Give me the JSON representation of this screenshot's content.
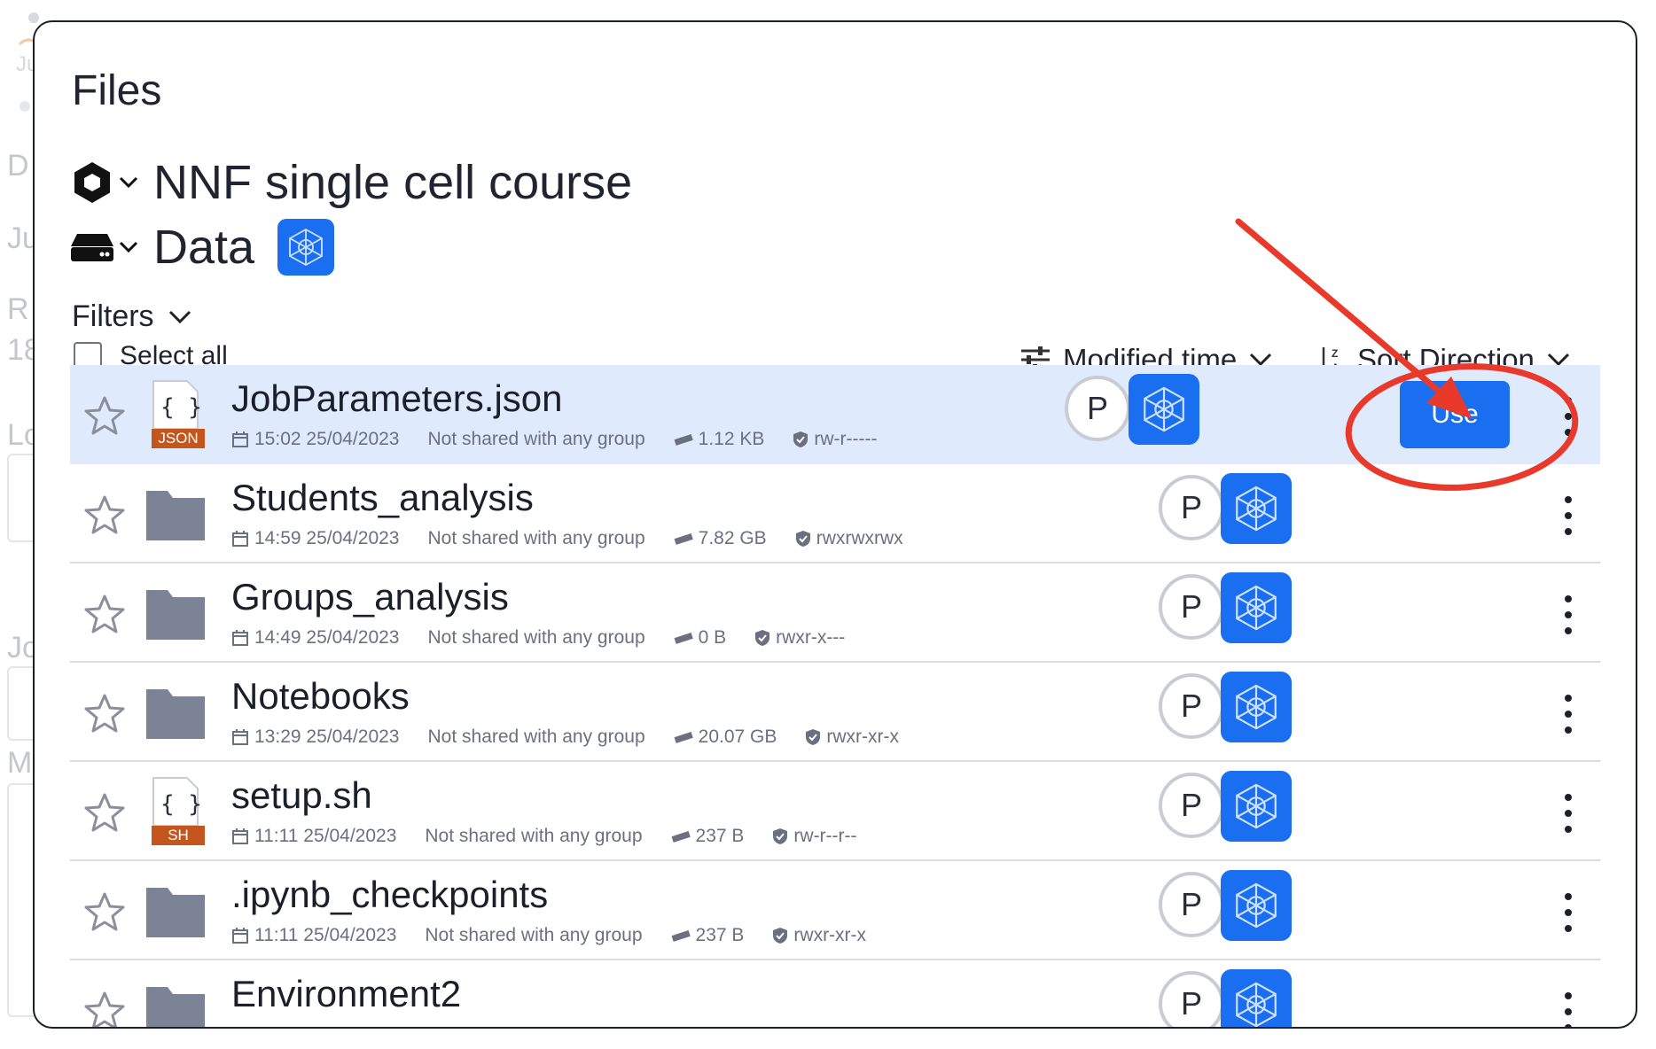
{
  "background": {
    "letters": [
      "D",
      "Ju",
      "R",
      "18",
      "Lo",
      "Jo",
      "M"
    ]
  },
  "modal": {
    "title": "Files",
    "project_breadcrumb": "NNF single cell course",
    "drive_breadcrumb": "Data",
    "filters_label": "Filters",
    "select_all_label": "Select all",
    "sort_field_label": "Modified time",
    "sort_direction_label": "Sort Direction",
    "use_button_label": "Use",
    "provider_badge_label": "P"
  },
  "colors": {
    "accent": "#1a6ff0",
    "selected_row": "#dfeafd",
    "json_badge": "#c2561c",
    "sh_badge": "#c2561c",
    "annotation": "#e8392b",
    "folder": "#7b8394"
  },
  "files": [
    {
      "name": "JobParameters.json",
      "type": "file",
      "badge": "JSON",
      "modified": "15:02 25/04/2023",
      "shared": "Not shared with any group",
      "size": "1.12 KB",
      "permissions": "rw-r-----",
      "selected": true
    },
    {
      "name": "Students_analysis",
      "type": "folder",
      "badge": "",
      "modified": "14:59 25/04/2023",
      "shared": "Not shared with any group",
      "size": "7.82 GB",
      "permissions": "rwxrwxrwx",
      "selected": false
    },
    {
      "name": "Groups_analysis",
      "type": "folder",
      "badge": "",
      "modified": "14:49 25/04/2023",
      "shared": "Not shared with any group",
      "size": "0 B",
      "permissions": "rwxr-x---",
      "selected": false
    },
    {
      "name": "Notebooks",
      "type": "folder",
      "badge": "",
      "modified": "13:29 25/04/2023",
      "shared": "Not shared with any group",
      "size": "20.07 GB",
      "permissions": "rwxr-xr-x",
      "selected": false
    },
    {
      "name": "setup.sh",
      "type": "file",
      "badge": "SH",
      "modified": "11:11 25/04/2023",
      "shared": "Not shared with any group",
      "size": "237 B",
      "permissions": "rw-r--r--",
      "selected": false
    },
    {
      "name": ".ipynb_checkpoints",
      "type": "folder",
      "badge": "",
      "modified": "11:11 25/04/2023",
      "shared": "Not shared with any group",
      "size": "237 B",
      "permissions": "rwxr-xr-x",
      "selected": false
    },
    {
      "name": "Environment2",
      "type": "folder",
      "badge": "",
      "modified": "",
      "shared": "",
      "size": "",
      "permissions": "",
      "selected": false
    }
  ],
  "icons": {
    "project": "hexagon-icon",
    "drive": "drive-icon",
    "chevron": "chevron-down-icon",
    "sort_field": "sliders-icon",
    "sort_direction": "sort-az-icon",
    "favorite": "star-icon",
    "folder": "folder-icon",
    "file": "code-file-icon",
    "calendar": "calendar-icon",
    "size": "ruler-icon",
    "permissions": "shield-icon",
    "provider": "network-icon",
    "more": "kebab-icon"
  }
}
